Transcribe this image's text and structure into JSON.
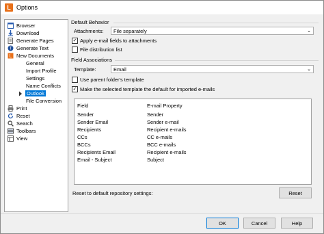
{
  "window": {
    "title": "Options",
    "app_icon_letter": "L"
  },
  "tree": {
    "items": [
      {
        "label": "Browser",
        "icon": "browser-icon"
      },
      {
        "label": "Download",
        "icon": "download-icon"
      },
      {
        "label": "Generate Pages",
        "icon": "generate-pages-icon"
      },
      {
        "label": "Generate Text",
        "icon": "generate-text-icon"
      },
      {
        "label": "New Documents",
        "icon": "new-documents-icon"
      },
      {
        "label": "General"
      },
      {
        "label": "Import Profile"
      },
      {
        "label": "Settings"
      },
      {
        "label": "Name Conflicts"
      },
      {
        "label": "Outlook",
        "selected": true
      },
      {
        "label": "File Conversion"
      },
      {
        "label": "Print",
        "icon": "print-icon"
      },
      {
        "label": "Reset",
        "icon": "reset-icon"
      },
      {
        "label": "Search",
        "icon": "search-icon"
      },
      {
        "label": "Toolbars",
        "icon": "toolbars-icon"
      },
      {
        "label": "View",
        "icon": "view-icon"
      }
    ]
  },
  "default_behavior": {
    "group_label": "Default Behavior",
    "attachments_label": "Attachments:",
    "attachments_value": "File separately",
    "apply_email_fields_label": "Apply e-mail fields to attachments",
    "apply_email_fields_checked": true,
    "file_distribution_list_label": "File distribution list",
    "file_distribution_list_checked": false
  },
  "field_associations": {
    "group_label": "Field Associations",
    "template_label": "Template:",
    "template_value": "Email",
    "use_parent_template_label": "Use parent folder's template",
    "use_parent_template_checked": false,
    "make_default_label": "Make the selected template the default for imported e-mails",
    "make_default_checked": true,
    "columns": [
      "Field",
      "E-mail Property"
    ],
    "rows": [
      [
        "Sender",
        "Sender"
      ],
      [
        "Sender Email",
        "Sender e-mail"
      ],
      [
        "Recipients",
        "Recipient e-mails"
      ],
      [
        "CCs",
        "CC e-mails"
      ],
      [
        "BCCs",
        "BCC e-mails"
      ],
      [
        "Recipients Email",
        "Recipient e-mails"
      ],
      [
        "Email - Subject",
        "Subject"
      ]
    ]
  },
  "reset": {
    "label": "Reset to default repository settings:",
    "button_label": "Reset"
  },
  "footer": {
    "ok_label": "OK",
    "cancel_label": "Cancel",
    "help_label": "Help"
  },
  "colors": {
    "selection": "#0078d7",
    "app_icon": "#e8701a"
  }
}
